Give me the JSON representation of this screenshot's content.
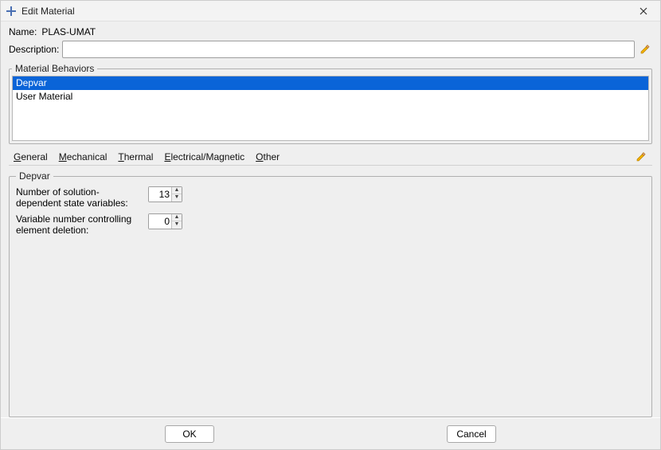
{
  "window": {
    "title": "Edit Material"
  },
  "name": {
    "label": "Name:",
    "value": "PLAS-UMAT"
  },
  "description": {
    "label": "Description:",
    "value": ""
  },
  "materialBehaviors": {
    "legend": "Material Behaviors",
    "items": [
      {
        "label": "Depvar",
        "selected": true
      },
      {
        "label": "User Material",
        "selected": false
      }
    ]
  },
  "categories": {
    "general": {
      "u": "G",
      "rest": "eneral"
    },
    "mechanical": {
      "u": "M",
      "rest": "echanical"
    },
    "thermal": {
      "u": "T",
      "rest": "hermal"
    },
    "electrical": {
      "u": "E",
      "rest": "lectrical/Magnetic"
    },
    "other": {
      "u": "O",
      "rest": "ther"
    }
  },
  "depvar": {
    "legend": "Depvar",
    "param1": {
      "label": "Number of solution-dependent state variables:",
      "value": "13"
    },
    "param2": {
      "label": "Variable number controlling element deletion:",
      "value": "0"
    }
  },
  "footer": {
    "ok": "OK",
    "cancel": "Cancel"
  }
}
